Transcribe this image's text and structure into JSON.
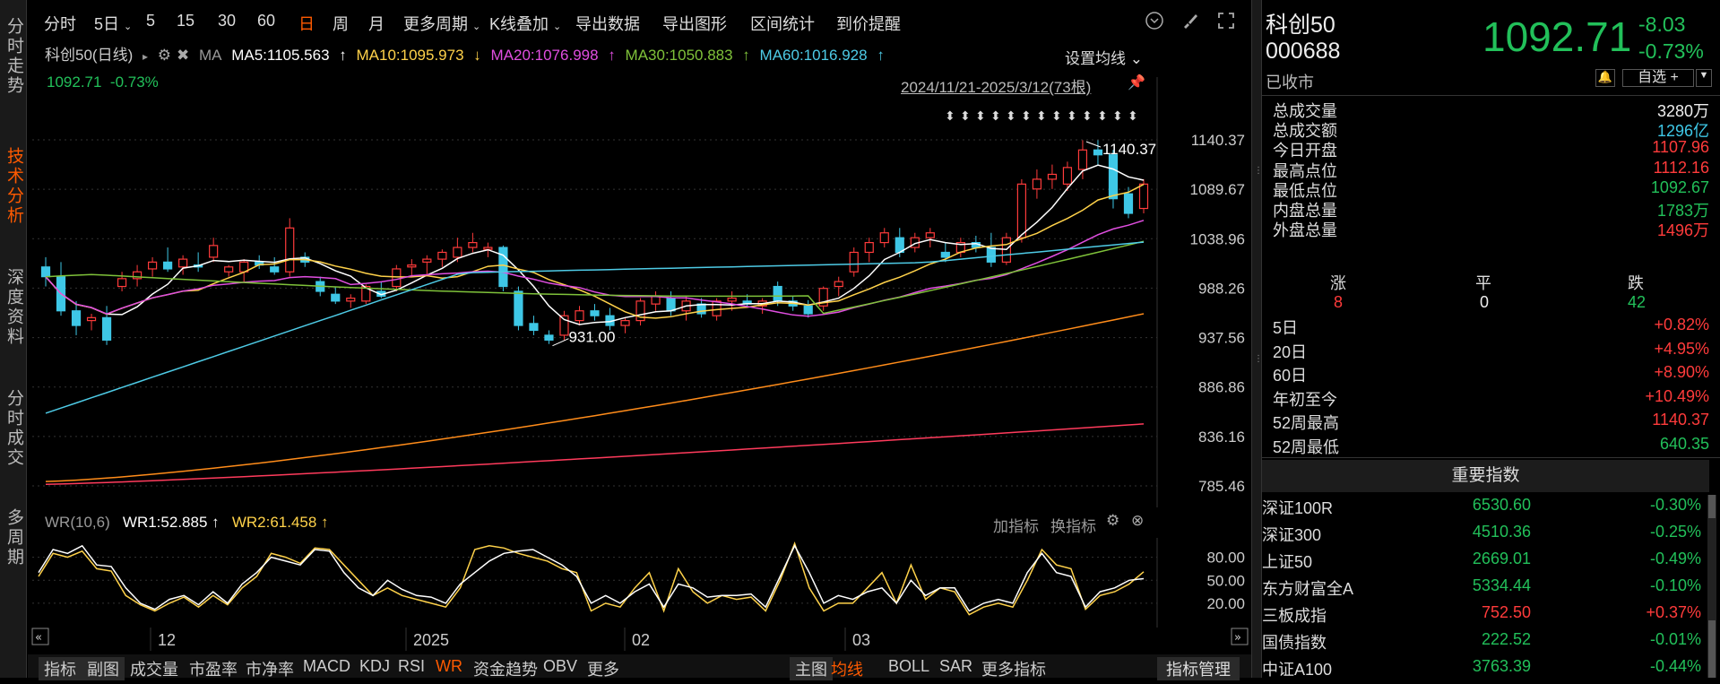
{
  "leftnav": [
    {
      "label": "分时走势",
      "active": false
    },
    {
      "label": "技术分析",
      "active": true
    },
    {
      "label": "深度资料",
      "active": false
    },
    {
      "label": "分时成交",
      "active": false
    },
    {
      "label": "多周期",
      "active": false
    }
  ],
  "topbar": {
    "items": [
      "分时",
      "5日",
      "5",
      "15",
      "30",
      "60",
      "日",
      "周",
      "月",
      "更多周期",
      "K线叠加",
      "导出数据",
      "导出图形",
      "区间统计",
      "到价提醒"
    ],
    "active": "日"
  },
  "ma": {
    "name": "科创50(日线)",
    "ma_label": "MA",
    "ma5": "MA5:1105.563",
    "ma10": "MA10:1095.973",
    "ma20": "MA20:1076.998",
    "ma30": "MA30:1050.883",
    "ma60": "MA60:1016.928",
    "settings": "设置均线"
  },
  "price_line": {
    "price": "1092.71",
    "pct": "-0.73%"
  },
  "range": "2024/11/21-2025/3/12(73根)",
  "annotations": {
    "high": "1140.37",
    "low": "931.00"
  },
  "yticks": [
    "1140.37",
    "1089.67",
    "1038.96",
    "988.26",
    "937.56",
    "886.86",
    "836.16",
    "785.46"
  ],
  "xticks": [
    "12",
    "2025",
    "02",
    "03"
  ],
  "wr": {
    "label": "WR(10,6)",
    "wr1": "WR1:52.885",
    "wr2": "WR2:61.458",
    "add": "加指标",
    "switch": "换指标",
    "yticks": [
      "80.00",
      "50.00",
      "20.00"
    ]
  },
  "bottombar": {
    "left": [
      "指标",
      "副图",
      "成交量",
      "市盈率",
      "市净率",
      "MACD",
      "KDJ",
      "RSI",
      "WR",
      "资金趋势",
      "OBV",
      "更多"
    ],
    "mid": [
      "主图",
      "均线",
      "BOLL",
      "SAR",
      "更多指标"
    ],
    "right": "指标管理",
    "active_left": "WR",
    "active_mid": "均线"
  },
  "quote": {
    "name": "科创50",
    "code": "000688",
    "status": "已收市",
    "price": "1092.71",
    "change": "-8.03",
    "pct": "-0.73%",
    "watch": "自选 +"
  },
  "stats": [
    {
      "label": "总成交量",
      "value": "3280万",
      "color": "white"
    },
    {
      "label": "总成交额",
      "value": "1296亿",
      "color": "cyan"
    },
    {
      "label": "今日开盘",
      "value": "1107.96",
      "color": "red"
    },
    {
      "label": "最高点位",
      "value": "1112.16",
      "color": "red"
    },
    {
      "label": "最低点位",
      "value": "1092.67",
      "color": "green"
    },
    {
      "label": "内盘总量",
      "value": "1783万",
      "color": "green"
    },
    {
      "label": "外盘总量",
      "value": "1496万",
      "color": "red"
    }
  ],
  "breadth": {
    "up_label": "涨",
    "flat_label": "平",
    "down_label": "跌",
    "up": "8",
    "flat": "0",
    "down": "42"
  },
  "perf": [
    {
      "label": "5日",
      "value": "+0.82%",
      "color": "red"
    },
    {
      "label": "20日",
      "value": "+4.95%",
      "color": "red"
    },
    {
      "label": "60日",
      "value": "+8.90%",
      "color": "red"
    },
    {
      "label": "年初至今",
      "value": "+10.49%",
      "color": "red"
    },
    {
      "label": "52周最高",
      "value": "1140.37",
      "color": "red"
    },
    {
      "label": "52周最低",
      "value": "640.35",
      "color": "green"
    }
  ],
  "indices_title": "重要指数",
  "indices": [
    {
      "name": "深证100R",
      "price": "6530.60",
      "pct": "-0.30%",
      "color": "green"
    },
    {
      "name": "深证300",
      "price": "4510.36",
      "pct": "-0.25%",
      "color": "green"
    },
    {
      "name": "上证50",
      "price": "2669.01",
      "pct": "-0.49%",
      "color": "green"
    },
    {
      "name": "东方财富全A",
      "price": "5334.44",
      "pct": "-0.10%",
      "color": "green"
    },
    {
      "name": "三板成指",
      "price": "752.50",
      "pct": "+0.37%",
      "color": "red"
    },
    {
      "name": "国债指数",
      "price": "222.52",
      "pct": "-0.01%",
      "color": "green"
    },
    {
      "name": "中证A100",
      "price": "3763.39",
      "pct": "-0.44%",
      "color": "green"
    }
  ],
  "colors": {
    "up": "#ff3b3b",
    "down": "#3ec7e6",
    "ma5": "#ffffff",
    "ma10": "#ffd24a",
    "ma20": "#e04ee0",
    "ma30": "#7fc23a",
    "ma60": "#4ecbe6",
    "ma120": "#ff8c1a",
    "ma250": "#ff3b5c",
    "accent": "#ff5a00"
  }
}
